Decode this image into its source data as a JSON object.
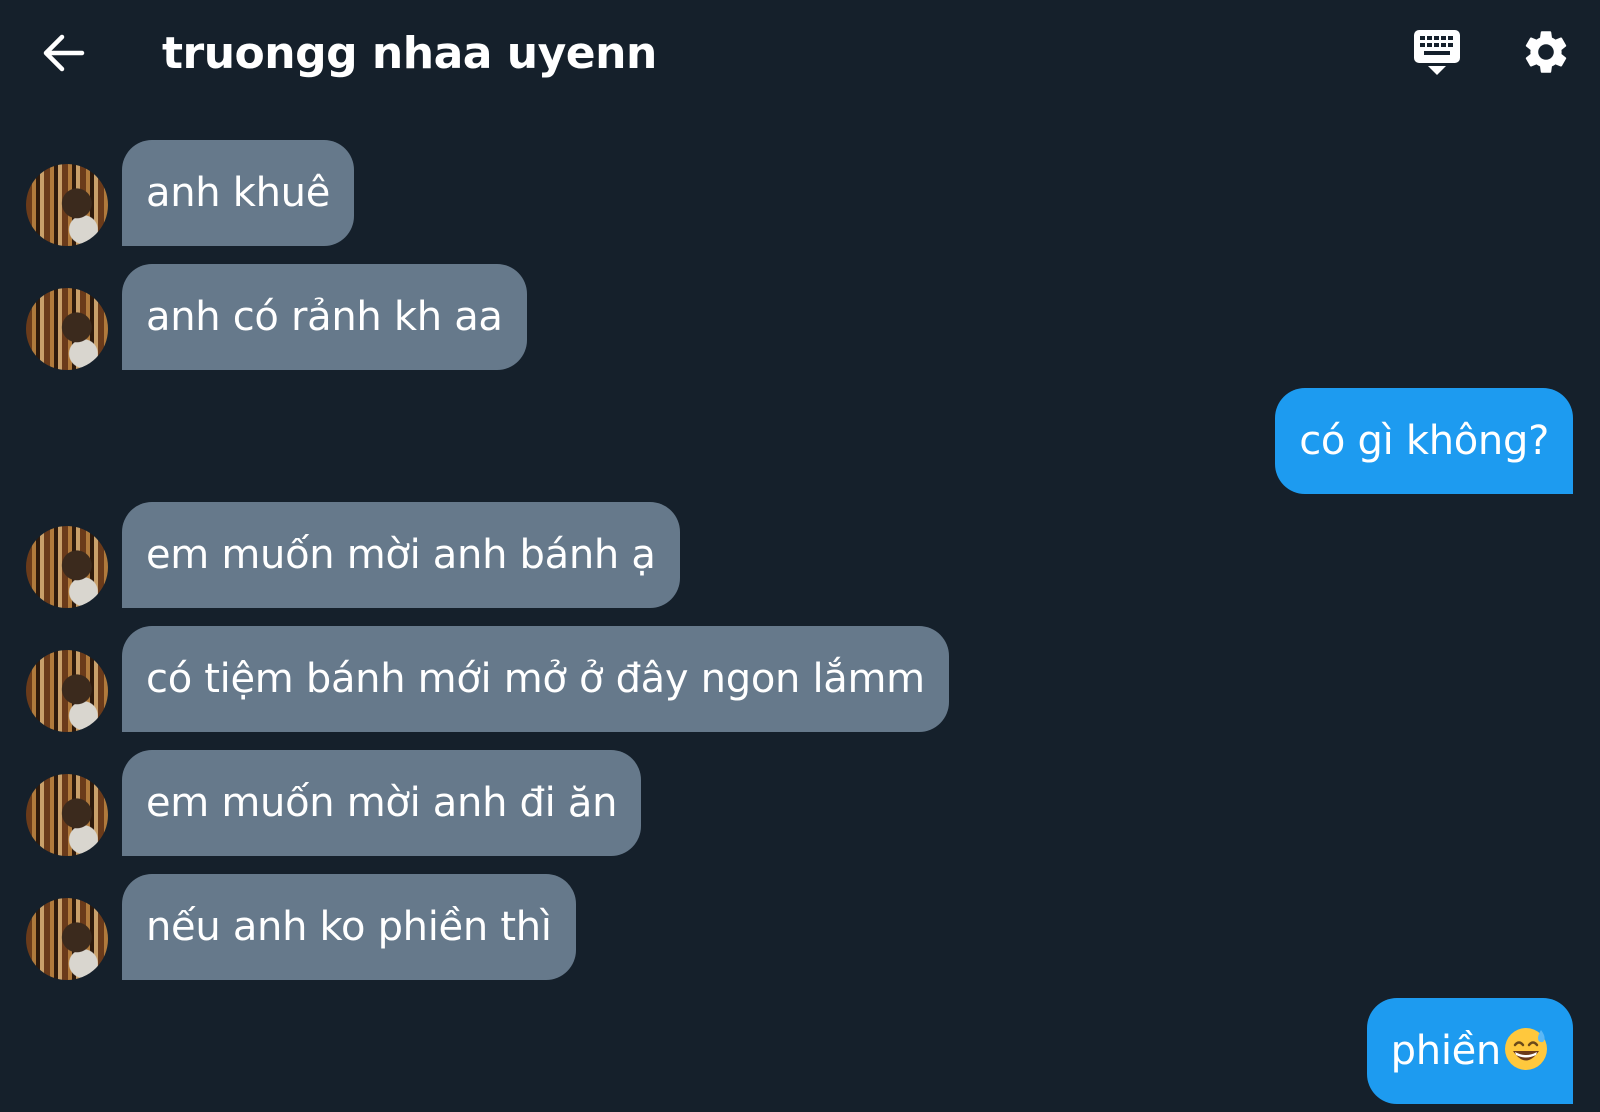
{
  "header": {
    "title": "truongg nhaa uyenn"
  },
  "icons": {
    "back": "arrow-left-icon",
    "keyboard": "keyboard-icon",
    "settings": "gear-icon"
  },
  "colors": {
    "background": "#15202b",
    "incoming_bubble": "#66798b",
    "outgoing_bubble": "#1d9bf0",
    "text": "#ffffff"
  },
  "messages": [
    {
      "direction": "incoming",
      "text": "anh khuê"
    },
    {
      "direction": "incoming",
      "text": "anh có rảnh kh aa"
    },
    {
      "direction": "outgoing",
      "text": "có gì không?"
    },
    {
      "direction": "incoming",
      "text": "em muốn mời anh bánh ạ"
    },
    {
      "direction": "incoming",
      "text": "có tiệm bánh mới mở ở đây ngon lắmm"
    },
    {
      "direction": "incoming",
      "text": "em muốn mời anh đi ăn"
    },
    {
      "direction": "incoming",
      "text": "nếu anh ko phiền thì"
    },
    {
      "direction": "outgoing",
      "text": "phiền",
      "emoji": "grinning-face-with-sweat"
    }
  ]
}
